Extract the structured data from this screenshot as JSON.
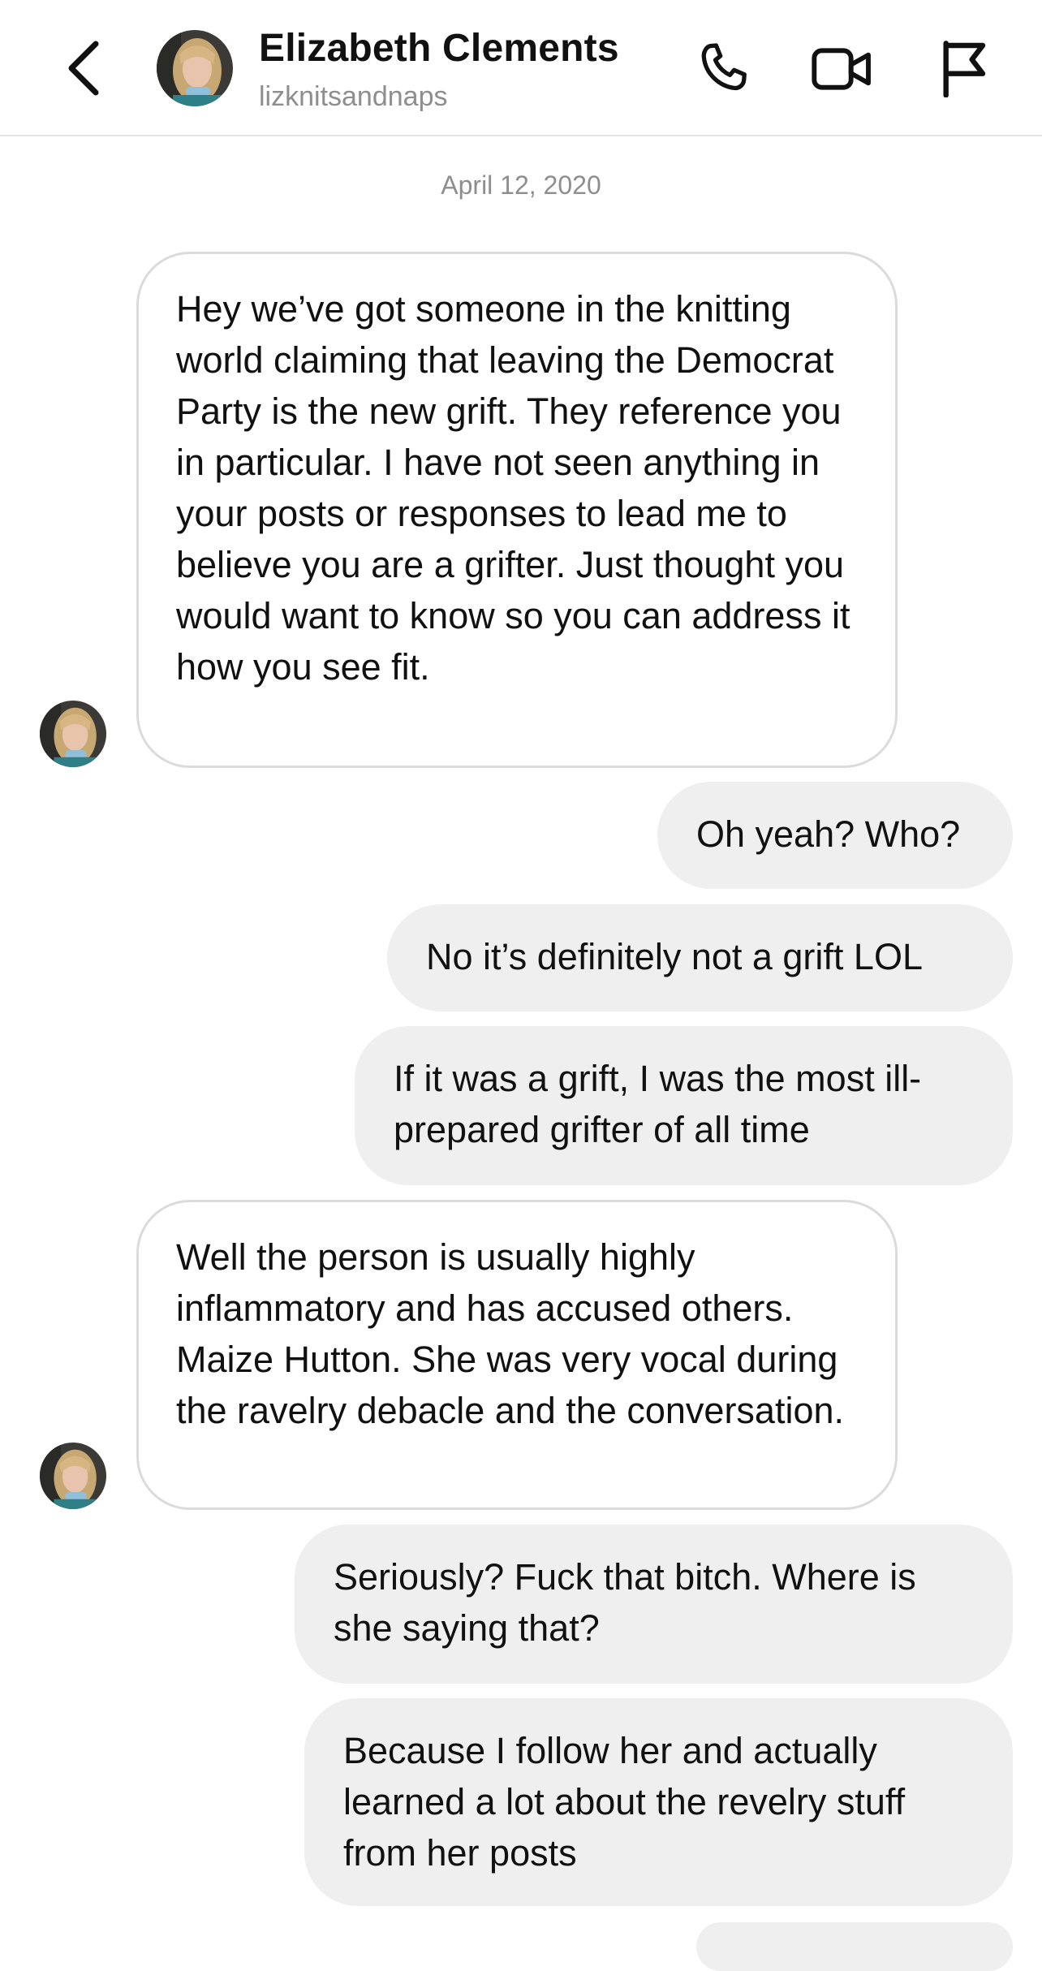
{
  "header": {
    "name": "Elizabeth Clements",
    "handle": "lizknitsandnaps",
    "icons": [
      "back-chevron-icon",
      "phone-icon",
      "video-icon",
      "flag-icon"
    ]
  },
  "conversation": {
    "date": "April 12, 2020",
    "messages": [
      {
        "from": "them",
        "text": "Hey we’ve got someone in the knitting world claiming that leaving the Democrat Party is the new grift. They reference you in particular. I have not seen anything in your posts or responses to lead me to believe you are a grifter. Just thought you would want to know so you can address it how you see fit."
      },
      {
        "from": "me",
        "text": "Oh yeah? Who?"
      },
      {
        "from": "me",
        "text": "No it’s definitely not a grift LOL"
      },
      {
        "from": "me",
        "text": "If it was a grift, I was the most ill-prepared grifter of all time"
      },
      {
        "from": "them",
        "text": "Well the person is usually highly inflammatory and has accused others. Maize Hutton. She was very vocal during the ravelry debacle and the conversation."
      },
      {
        "from": "me",
        "text": "Seriously? Fuck that bitch. Where is she saying that?"
      },
      {
        "from": "me",
        "text": "Because I follow her and actually learned a lot about the revelry stuff from her posts"
      }
    ]
  },
  "colors": {
    "incoming_bubble": "#ffffff",
    "incoming_border": "#dbdbdb",
    "outgoing_bubble": "#efefef",
    "secondary_text": "#8e8e8e"
  }
}
